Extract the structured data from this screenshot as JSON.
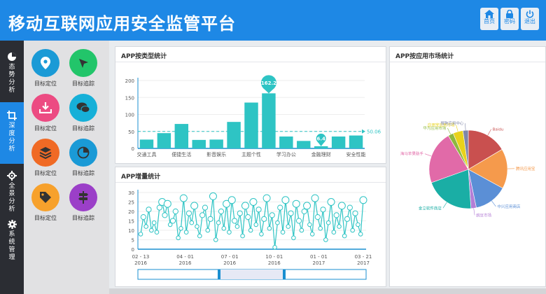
{
  "header": {
    "title": "移动互联网应用安全监管平台",
    "buttons": [
      {
        "label": "首页",
        "icon": "home-icon"
      },
      {
        "label": "密码",
        "icon": "lock-icon"
      },
      {
        "label": "退出",
        "icon": "power-icon"
      }
    ]
  },
  "sidebar": {
    "items": [
      {
        "label": "态势分析",
        "icon": "pie-icon",
        "active": false
      },
      {
        "label": "深度分析",
        "icon": "crop-icon",
        "active": true
      },
      {
        "label": "全景分析",
        "icon": "cog-icon",
        "active": false
      },
      {
        "label": "系统管理",
        "icon": "gear-icon",
        "active": false
      }
    ]
  },
  "tiles": [
    {
      "label": "目标定位",
      "color": "#1a9ad6",
      "icon": "map-pin-icon"
    },
    {
      "label": "目标追踪",
      "color": "#22c56a",
      "icon": "cursor-icon"
    },
    {
      "label": "目标定位",
      "color": "#ec4b82",
      "icon": "download-icon"
    },
    {
      "label": "目标追踪",
      "color": "#16b0d8",
      "icon": "chat-icon"
    },
    {
      "label": "目标定位",
      "color": "#f06a25",
      "icon": "layers-icon"
    },
    {
      "label": "目标追踪",
      "color": "#1a9ad6",
      "icon": "pie-chart-icon"
    },
    {
      "label": "目标定位",
      "color": "#f7a12c",
      "icon": "tag-icon"
    },
    {
      "label": "目标追踪",
      "color": "#9b3fc8",
      "icon": "signpost-icon"
    }
  ],
  "colors": {
    "accent": "#1e88e5",
    "series": "#2ec4c4"
  },
  "chart_data": [
    {
      "type": "bar",
      "title": "APP按类型统计",
      "categories": [
        "交通工具",
        "",
        "便捷生活",
        "",
        "影音娱乐",
        "",
        "主题个性",
        "",
        "学习办公",
        "",
        "金融理财",
        "",
        "安全性能"
      ],
      "values": [
        26,
        45,
        72,
        25,
        26,
        78,
        135,
        162.2,
        35,
        22,
        6.4,
        35,
        38
      ],
      "ylim": [
        0,
        200
      ],
      "yticks": [
        0,
        50,
        100,
        150,
        200
      ],
      "xtick_labels": [
        "交通工具",
        "便捷生活",
        "影音娱乐",
        "主题个性",
        "学习办公",
        "金融理财",
        "安全性能"
      ],
      "max_label": "162.2",
      "min_label": "6.4",
      "average_label": "50.06",
      "average": 50.06
    },
    {
      "type": "pie",
      "title": "APP按应用市场统计",
      "labels": [
        "Baidu",
        "腾讯应用宝",
        "中兴应用商店",
        "豌豆市场",
        "金立软件商店",
        "海马苹果助手",
        "华为应用市场",
        "应用宝应用市场",
        "搜狗应用中心"
      ],
      "values": [
        60,
        60,
        50,
        8,
        75,
        80,
        8,
        15,
        8
      ],
      "colors": [
        "#c9504f",
        "#f59a4c",
        "#5b8fd6",
        "#b47ed6",
        "#1aaea5",
        "#e16aa8",
        "#8db83f",
        "#e9d21a",
        "#7f86a8"
      ]
    },
    {
      "type": "line",
      "title": "APP增量统计",
      "ylim": [
        0,
        30
      ],
      "yticks": [
        0,
        5,
        10,
        15,
        20,
        25,
        30
      ],
      "xtick_labels": [
        "02 - 13\n2016",
        "04 - 01\n2016",
        "07 - 01\n2016",
        "10 - 01\n2016",
        "01 - 01\n2017",
        "03 - 21\n2017"
      ],
      "values": [
        8,
        17,
        12,
        21,
        10,
        14,
        9,
        22,
        25,
        18,
        24,
        13,
        15,
        20,
        6,
        11,
        27,
        9,
        19,
        14,
        23,
        12,
        7,
        18,
        22,
        10,
        16,
        28,
        5,
        14,
        20,
        11,
        24,
        9,
        26,
        15,
        12,
        19,
        7,
        23,
        17,
        10,
        25,
        13,
        21,
        8,
        16,
        27,
        11,
        18,
        1,
        14,
        22,
        9,
        26,
        12,
        19,
        6,
        24,
        15,
        10,
        20,
        23,
        13,
        8,
        27,
        17,
        11,
        21,
        5,
        14,
        25,
        9,
        18,
        12,
        23,
        7,
        16,
        22,
        10,
        19,
        13,
        8,
        26
      ]
    }
  ]
}
